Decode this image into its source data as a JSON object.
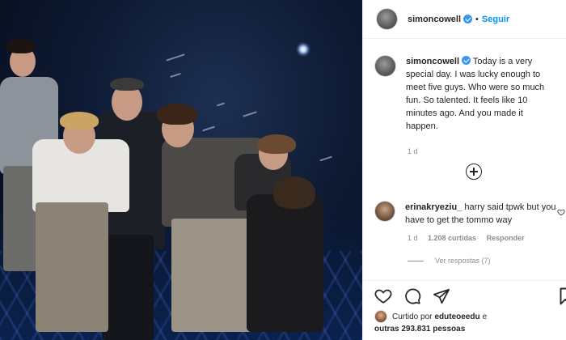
{
  "post": {
    "photo_description_icon": "photo"
  },
  "header": {
    "username": "simoncowell",
    "separator": "•",
    "follow_label": "Seguir"
  },
  "caption": {
    "username": "simoncowell",
    "text": "Today is a very special day. I was lucky enough to meet five guys. Who were so much fun. So talented. It feels like 10 minutes ago. And you made it happen.",
    "time": "1 d"
  },
  "comment": {
    "username": "erinakryeziu_",
    "text": "harry said tpwk but you have to get the tommo way",
    "time": "1 d",
    "likes": "1.208 curtidas",
    "reply_label": "Responder",
    "view_replies": "Ver respostas (7)"
  },
  "likes": {
    "prefix": "Curtido por",
    "user": "eduteoeedu",
    "conjunction": "e",
    "others": "outras 293.831 pessoas"
  },
  "colors": {
    "link_blue": "#0095f6",
    "verified_blue": "#3897f0",
    "muted": "#8e8e8e",
    "text": "#262626"
  }
}
